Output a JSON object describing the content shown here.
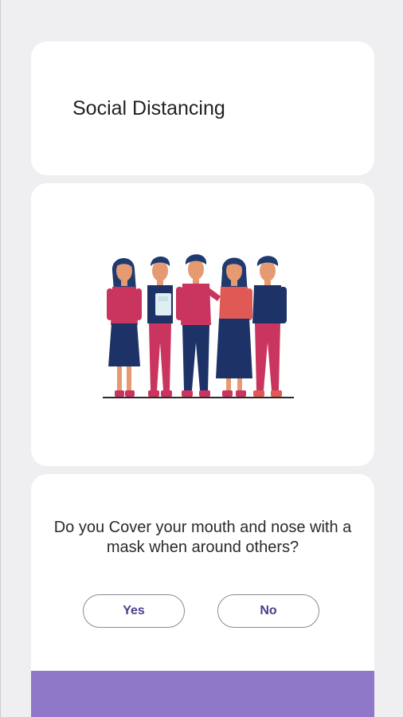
{
  "header": {
    "title": "Social Distancing"
  },
  "illustration": {
    "icon": "group-of-people-illustration"
  },
  "question": {
    "text": "Do you Cover your mouth and nose with a mask when around others?",
    "yes_label": "Yes",
    "no_label": "No"
  },
  "colors": {
    "background": "#efeff1",
    "card": "#ffffff",
    "accent": "#9078c8",
    "button_text": "#4b3f8e"
  }
}
